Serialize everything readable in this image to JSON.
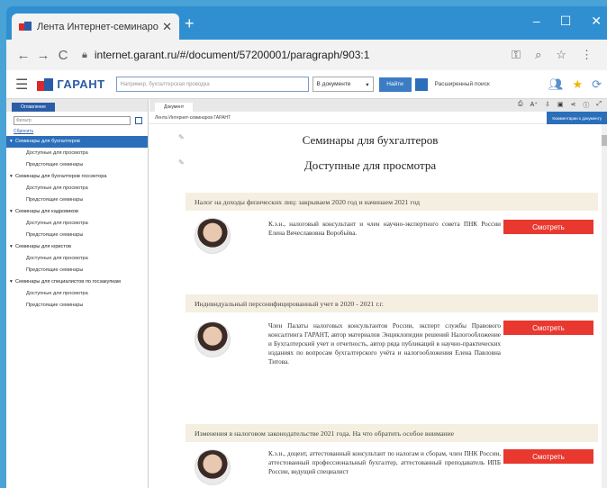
{
  "browser": {
    "tab_title": "Лента Интернет-семинаров ГАРАНТ",
    "new_tab": "+",
    "close": "✕",
    "win_min": "–",
    "win_max": "☐",
    "win_close": "✕",
    "back": "←",
    "forward": "→",
    "reload": "C",
    "url": "internet.garant.ru/#/document/57200001/paragraph/903:1"
  },
  "toolbar": {
    "logo": "ГАРАНТ",
    "search_placeholder": "Например, бухгалтерская проводка",
    "scope": "В документе",
    "find": "Найти",
    "advanced": "Расширенный поиск"
  },
  "left_panel": {
    "tab": "Оглавление",
    "filter_placeholder": "Фильтр",
    "reset": "Сбросить",
    "items": [
      {
        "label": "Семинары для бухгалтеров",
        "level": 1,
        "active": true
      },
      {
        "label": "Доступные для просмотра",
        "level": 2
      },
      {
        "label": "Предстоящие семинары",
        "level": 2
      },
      {
        "label": "Семинары для бухгалтеров госсектора",
        "level": 1
      },
      {
        "label": "Доступные для просмотра",
        "level": 2
      },
      {
        "label": "Предстоящие семинары",
        "level": 2
      },
      {
        "label": "Семинары для кадровиков",
        "level": 1
      },
      {
        "label": "Доступные для просмотра",
        "level": 2
      },
      {
        "label": "Предстоящие семинары",
        "level": 2
      },
      {
        "label": "Семинары для юристов",
        "level": 1
      },
      {
        "label": "Доступные для просмотра",
        "level": 2
      },
      {
        "label": "Предстоящие семинары",
        "level": 2
      },
      {
        "label": "Семинары для специалистов по госзакупкам",
        "level": 1
      },
      {
        "label": "Доступные для просмотра",
        "level": 2
      },
      {
        "label": "Предстоящие семинары",
        "level": 2
      }
    ]
  },
  "document": {
    "tab": "Документ",
    "breadcrumb": "Лента Интернет-семинаров ГАРАНТ",
    "right_strip": "Комментарии к документу",
    "title": "Семинары для бухгалтеров",
    "subtitle": "Доступные для просмотра",
    "watch_label": "Смотреть",
    "seminars": [
      {
        "title": "Налог на доходы физических лиц: закрываем 2020 год и начинаем 2021 год",
        "description": "К.э.н., налоговый консультант и член научно-экспертного совета ПНК России Елена Вячеславовна Воробьёва."
      },
      {
        "title": "Индивидуальный персонифицированный учет в 2020 - 2021 г.г.",
        "description": "Член Палаты налоговых консультантов России, эксперт службы Правового консалтинга ГАРАНТ, автор материалов Энциклопедии решений Налогообложение и Бухгалтерский учет и отчетность, автор ряда публикаций в научно-практических изданиях по вопросам бухгалтерского учёта и налогообложения Елена Павловна Титова."
      },
      {
        "title": "Изменения в налоговом законодательстве 2021 года. На что обратить особое внимание",
        "description": "К.э.н., доцент, аттестованный консультант по налогам и сборам, член ПНК России, аттестованный профессиональный бухгалтер, аттестованный преподаватель ИПБ России, ведущий специалист"
      }
    ]
  },
  "colors": {
    "chrome": "#2f8fd1",
    "accent": "#2b6fba",
    "watch_button": "#e8382f",
    "seminar_header": "#f4efe0"
  }
}
